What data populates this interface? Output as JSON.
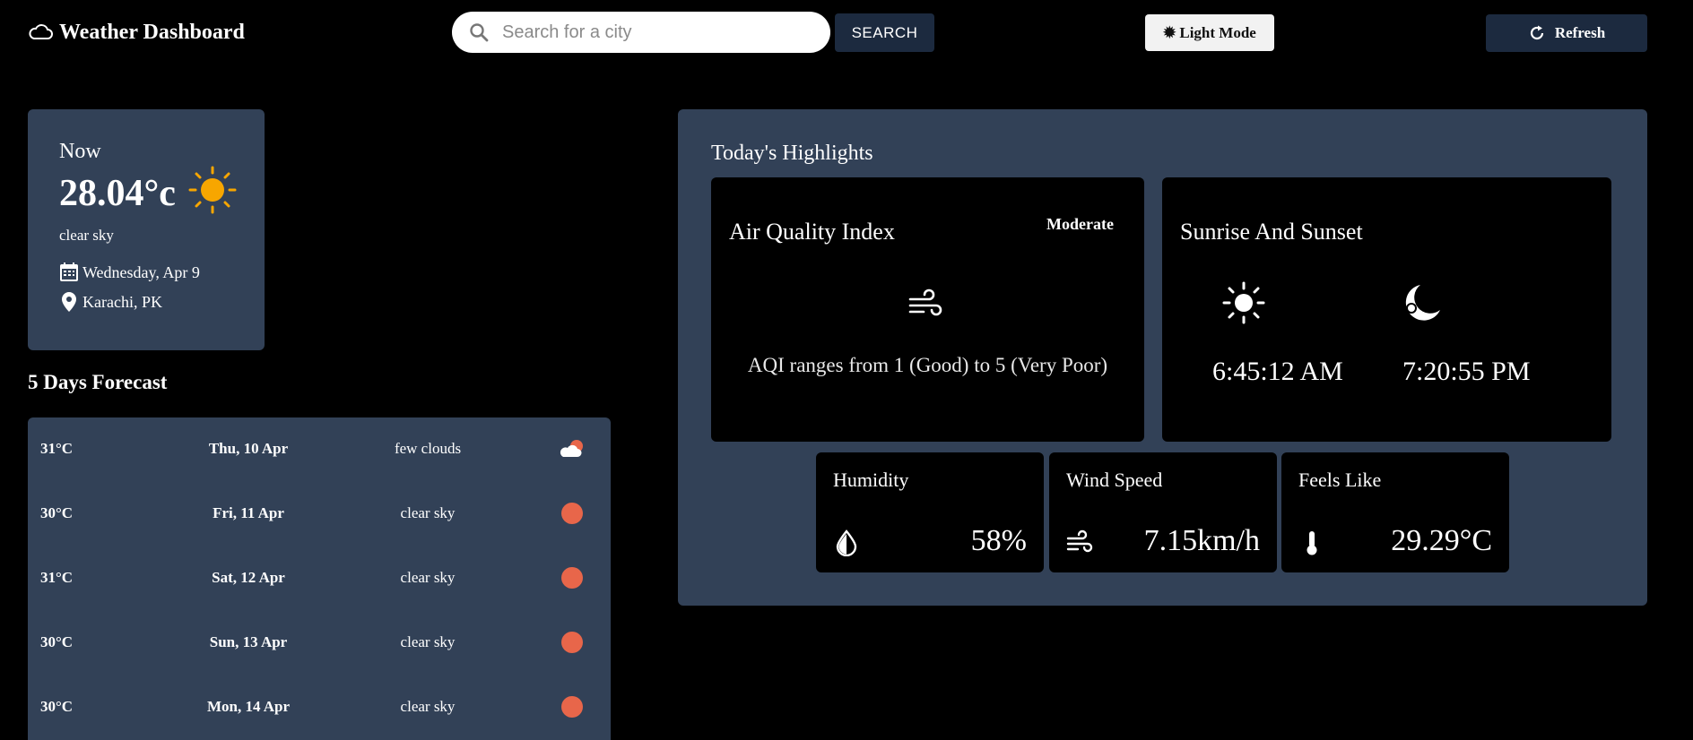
{
  "header": {
    "title": "Weather Dashboard",
    "logo_icon": "cloud-icon",
    "search": {
      "placeholder": "Search for a city",
      "value": "",
      "button_label": "SEARCH"
    },
    "mode_button": {
      "icon": "sun-small-icon",
      "label": "Light Mode"
    },
    "refresh_button": {
      "icon": "refresh-icon",
      "label": "Refresh"
    }
  },
  "current": {
    "label": "Now",
    "temperature": "28.04°c",
    "icon": "sun-icon",
    "description": "clear sky",
    "date": "Wednesday, Apr 9",
    "location": "Karachi, PK"
  },
  "forecast": {
    "title": "5 Days Forecast",
    "items": [
      {
        "temp": "31°C",
        "date": "Thu, 10 Apr",
        "condition": "few clouds",
        "icon": "few-clouds-icon"
      },
      {
        "temp": "30°C",
        "date": "Fri, 11 Apr",
        "condition": "clear sky",
        "icon": "clear-sky-icon"
      },
      {
        "temp": "31°C",
        "date": "Sat, 12 Apr",
        "condition": "clear sky",
        "icon": "clear-sky-icon"
      },
      {
        "temp": "30°C",
        "date": "Sun, 13 Apr",
        "condition": "clear sky",
        "icon": "clear-sky-icon"
      },
      {
        "temp": "30°C",
        "date": "Mon, 14 Apr",
        "condition": "clear sky",
        "icon": "clear-sky-icon"
      }
    ]
  },
  "highlights": {
    "title": "Today's Highlights",
    "aqi": {
      "title": "Air Quality Index",
      "badge": "Moderate",
      "icon": "wind-icon",
      "description": "AQI ranges from 1 (Good) to 5 (Very Poor)"
    },
    "sun": {
      "title": "Sunrise And Sunset",
      "sunrise": "6:45:12 AM",
      "sunset": "7:20:55 PM"
    },
    "humidity": {
      "label": "Humidity",
      "value": "58%",
      "icon": "humidity-icon"
    },
    "wind": {
      "label": "Wind Speed",
      "value": "7.15km/h",
      "icon": "wind-icon"
    },
    "feels_like": {
      "label": "Feels Like",
      "value": "29.29°C",
      "icon": "thermometer-icon"
    }
  },
  "colors": {
    "panel": "#324157",
    "button_dark": "#1c2a3f",
    "sun": "#f7a600",
    "dot": "#e8664a"
  }
}
